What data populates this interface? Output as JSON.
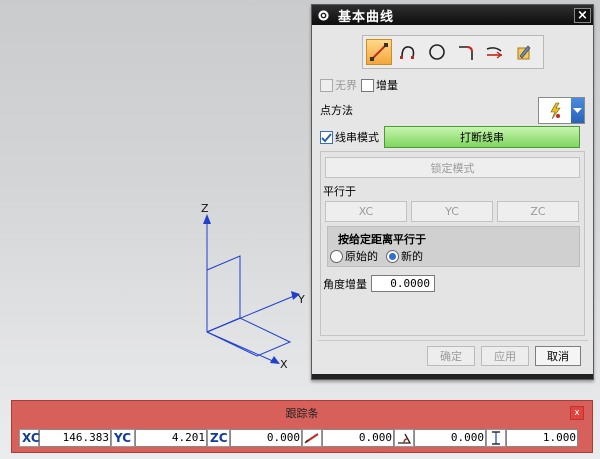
{
  "dialog": {
    "title": "基本曲线",
    "close_glyph": "×",
    "curve_tools": [
      {
        "name": "line-tool-icon",
        "active": true
      },
      {
        "name": "arc-tool-icon",
        "active": false
      },
      {
        "name": "circle-tool-icon",
        "active": false
      },
      {
        "name": "fillet-tool-icon",
        "active": false
      },
      {
        "name": "trim-tool-icon",
        "active": false
      },
      {
        "name": "edit-parameter-tool-icon",
        "active": false
      }
    ],
    "unbounded_label": "无界",
    "incremental_label": "增量",
    "point_method_label": "点方法",
    "string_mode_label": "线串模式",
    "break_string_label": "打断线串",
    "lock_mode_label": "锁定模式",
    "parallel_to_label": "平行于",
    "parallel_buttons": [
      "XC",
      "YC",
      "ZC"
    ],
    "offset_parallel_label": "按给定距离平行于",
    "original_label": "原始的",
    "new_label": "新的",
    "angle_increment_label": "角度增量",
    "angle_increment_value": "0.0000",
    "ok_label": "确定",
    "apply_label": "应用",
    "cancel_label": "取消"
  },
  "tracking_bar": {
    "title": "跟踪条",
    "close_glyph": "x",
    "xc_label": "XC",
    "xc_value": "146.383",
    "yc_label": "YC",
    "yc_value": "4.201",
    "zc_label": "ZC",
    "zc_value": "0.000",
    "length_value": "0.000",
    "angle_value": "0.000",
    "offset_value": "1.000"
  },
  "triad": {
    "x_label": "X",
    "y_label": "Y",
    "z_label": "Z"
  },
  "colors": {
    "accent_blue": "#2a62b8",
    "triad_blue": "#1f3fcf",
    "tracking_bar_red": "#d8605b",
    "break_button_green": "#7fd65f"
  }
}
